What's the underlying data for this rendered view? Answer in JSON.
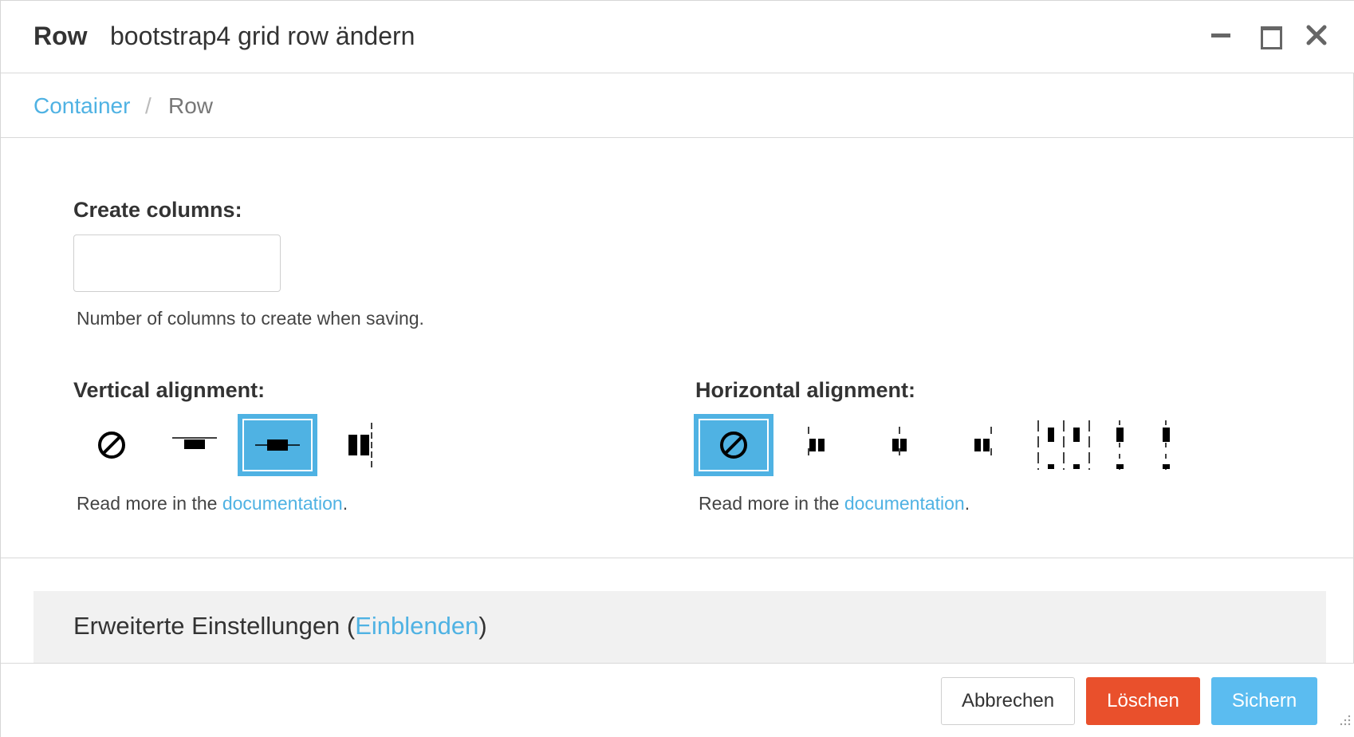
{
  "header": {
    "title_strong": "Row",
    "title_text": "bootstrap4 grid row ändern"
  },
  "breadcrumb": {
    "parent": "Container",
    "separator": "/",
    "current": "Row"
  },
  "form": {
    "create_columns": {
      "label": "Create columns:",
      "value": "",
      "help": "Number of columns to create when saving."
    },
    "vertical_alignment": {
      "label": "Vertical alignment:",
      "selected_index": 2,
      "options": [
        "none-icon",
        "align-top-icon",
        "align-center-icon",
        "align-bottom-icon"
      ],
      "help_prefix": "Read more in the ",
      "help_link": "documentation",
      "help_suffix": "."
    },
    "horizontal_alignment": {
      "label": "Horizontal alignment:",
      "selected_index": 0,
      "options": [
        "none-icon",
        "justify-start-icon",
        "justify-center-icon",
        "justify-end-icon",
        "justify-around-icon",
        "justify-between-icon"
      ],
      "help_prefix": "Read more in the ",
      "help_link": "documentation",
      "help_suffix": "."
    }
  },
  "advanced": {
    "title": "Erweiterte Einstellungen (",
    "toggle_link": "Einblenden",
    "title_suffix": ")"
  },
  "footer": {
    "cancel_label": "Abbrechen",
    "delete_label": "Löschen",
    "save_label": "Sichern"
  },
  "colors": {
    "accent": "#4fb2e3",
    "danger": "#e9502c",
    "primary": "#5bbcf0"
  }
}
